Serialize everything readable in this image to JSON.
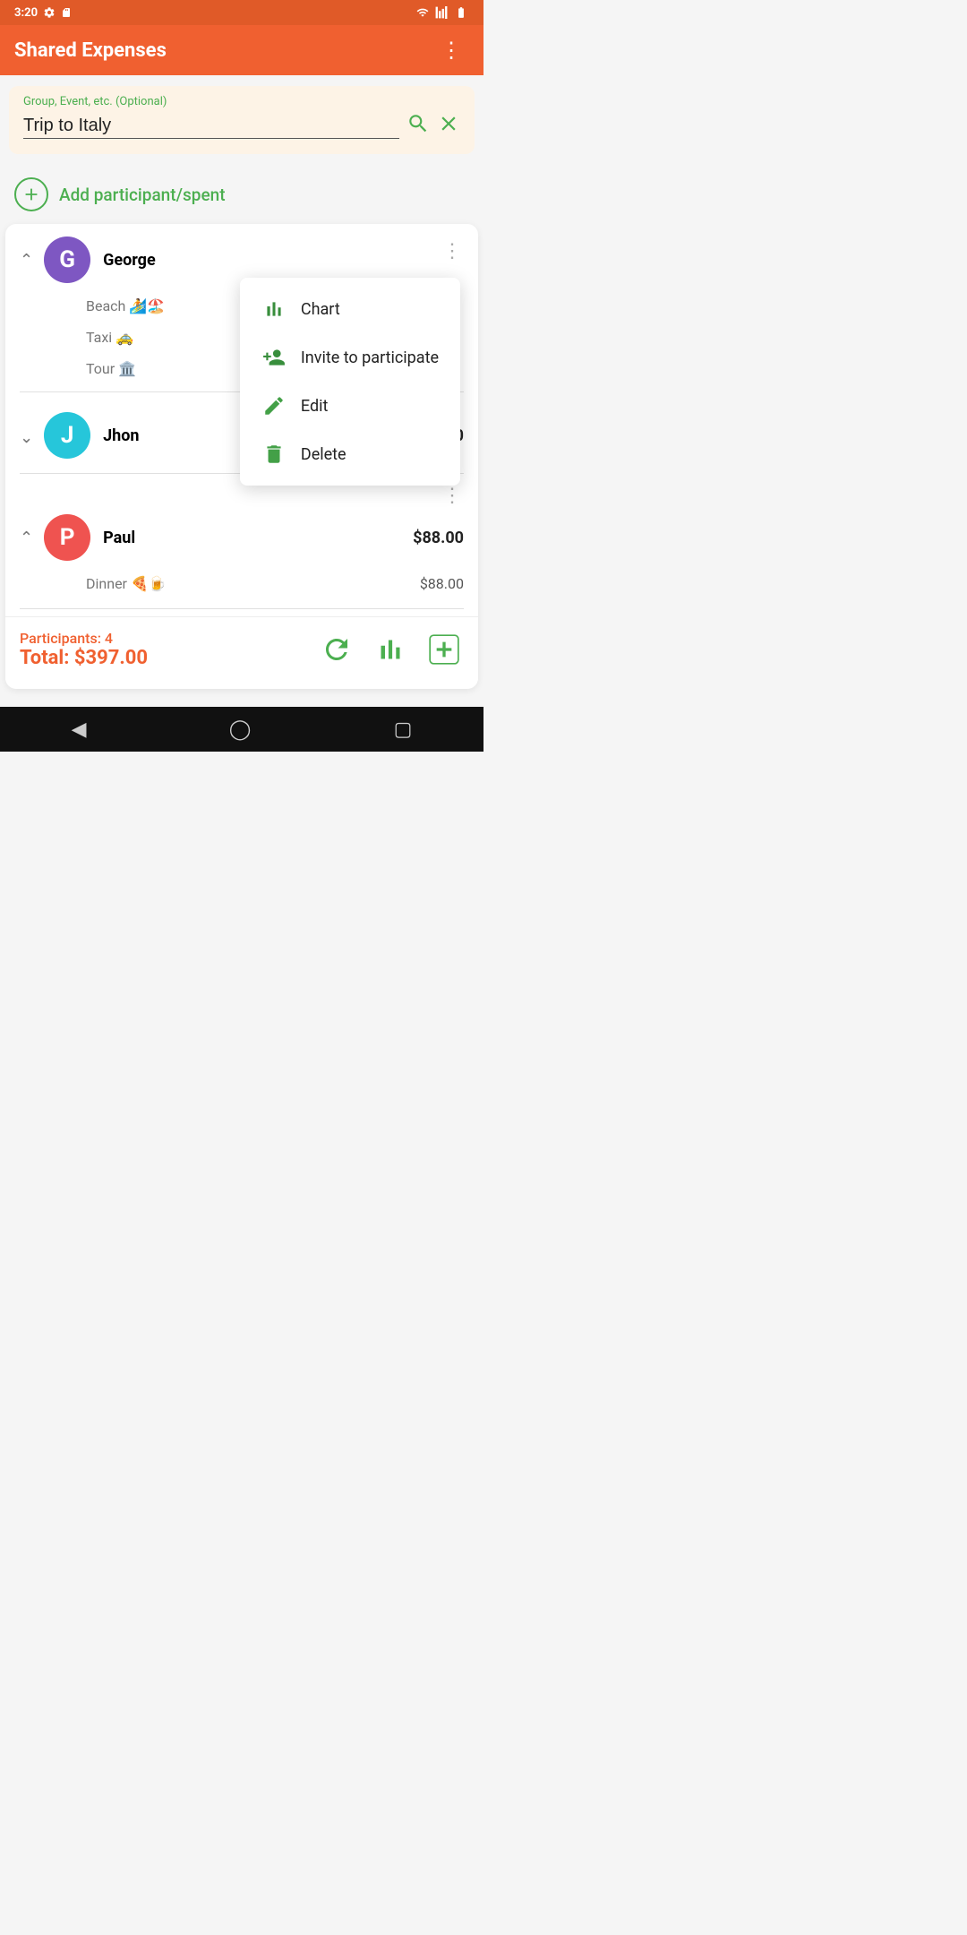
{
  "statusBar": {
    "time": "3:20",
    "icons": [
      "settings",
      "sd-card",
      "wifi",
      "signal",
      "battery"
    ]
  },
  "appBar": {
    "title": "Shared Expenses",
    "menuIcon": "more-vert"
  },
  "searchBox": {
    "label": "Group, Event, etc. (Optional)",
    "value": "Trip to Italy",
    "searchIconLabel": "search",
    "clearIconLabel": "clear"
  },
  "addParticipant": {
    "label": "Add participant/spent"
  },
  "participants": [
    {
      "id": "george",
      "initial": "G",
      "name": "George",
      "amount": "",
      "expanded": true,
      "expenses": [
        {
          "label": "Beach 🏄🏖️",
          "amount": ""
        },
        {
          "label": "Taxi 🚕",
          "amount": ""
        },
        {
          "label": "Tour 🏛️",
          "amount": ""
        }
      ]
    },
    {
      "id": "jhon",
      "initial": "J",
      "name": "Jhon",
      "amount": "$0.00",
      "expanded": false,
      "expenses": []
    },
    {
      "id": "paul",
      "initial": "P",
      "name": "Paul",
      "amount": "$88.00",
      "expanded": true,
      "expenses": [
        {
          "label": "Dinner 🍕🍺",
          "amount": "$88.00"
        }
      ]
    }
  ],
  "contextMenu": {
    "items": [
      {
        "id": "chart",
        "label": "Chart",
        "icon": "chart"
      },
      {
        "id": "invite",
        "label": "Invite to participate",
        "icon": "invite"
      },
      {
        "id": "edit",
        "label": "Edit",
        "icon": "edit"
      },
      {
        "id": "delete",
        "label": "Delete",
        "icon": "delete"
      }
    ]
  },
  "footer": {
    "participantsLabel": "Participants: 4",
    "totalLabel": "Total: $397.00",
    "refreshIcon": "refresh",
    "chartIcon": "bar-chart",
    "addIcon": "add-box"
  }
}
